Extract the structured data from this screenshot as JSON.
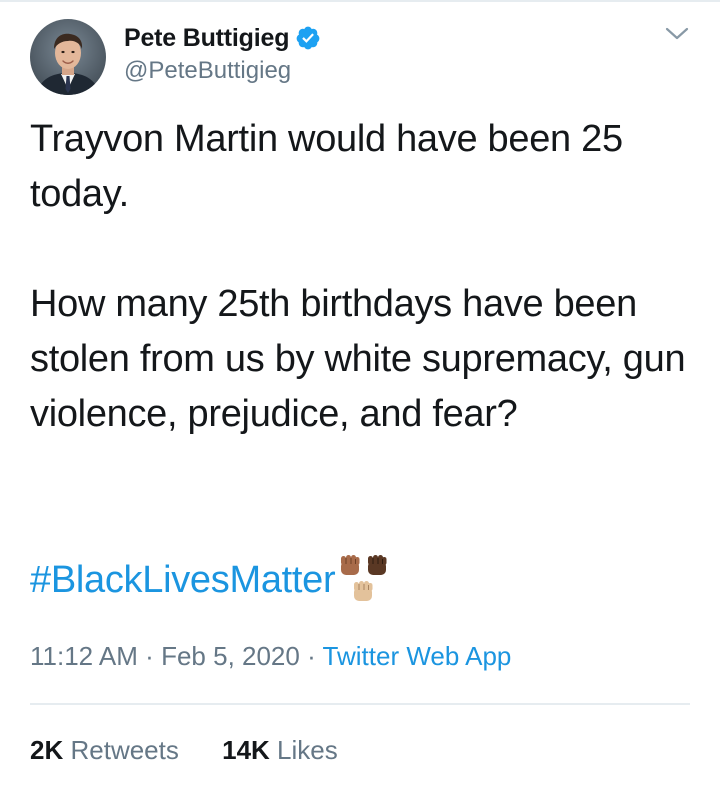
{
  "author": {
    "display_name": "Pete Buttigieg",
    "handle": "@PeteButtigieg",
    "verified": true,
    "avatar_icon": "profile-photo"
  },
  "tweet": {
    "paragraphs": [
      "Trayvon Martin would have been 25 today.",
      "How many 25th birthdays have been stolen from us by white supremacy, gun violence, prejudice, and fear?"
    ],
    "hashtag": "#BlackLivesMatter",
    "emoji_icon": "raised-fists-skin-tones-icon"
  },
  "meta": {
    "time": "11:12 AM",
    "separator": "·",
    "date": "Feb 5, 2020",
    "source": "Twitter Web App"
  },
  "stats": {
    "retweets_count": "2K",
    "retweets_label": "Retweets",
    "likes_count": "14K",
    "likes_label": "Likes"
  },
  "colors": {
    "text_primary": "#14171a",
    "text_secondary": "#657786",
    "link": "#1b95e0",
    "verified_badge": "#1da1f2",
    "divider": "#e6ecf0"
  },
  "icons": {
    "menu": "chevron-down-icon",
    "verified": "verified-badge-icon"
  }
}
